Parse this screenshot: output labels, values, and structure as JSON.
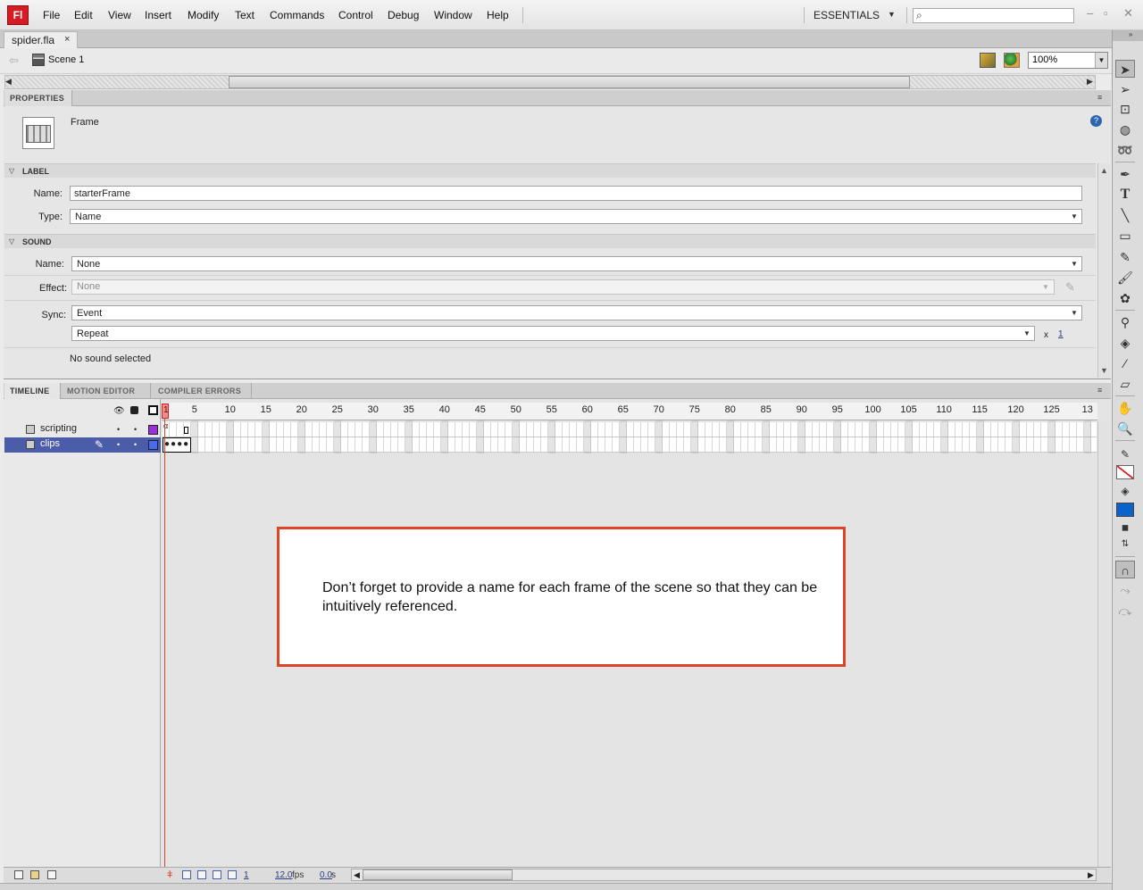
{
  "app": {
    "logo": "Fl",
    "menus": [
      "File",
      "Edit",
      "View",
      "Insert",
      "Modify",
      "Text",
      "Commands",
      "Control",
      "Debug",
      "Window",
      "Help"
    ],
    "workspace": "ESSENTIALS",
    "search": {
      "value": "",
      "placeholder": ""
    }
  },
  "document": {
    "tab_label": "spider.fla",
    "close_glyph": "×",
    "scene": "Scene 1",
    "zoom": "100%"
  },
  "properties": {
    "tab": "PROPERTIES",
    "selection_type": "Frame",
    "label_section": {
      "title": "LABEL",
      "name_label": "Name:",
      "name_value": "starterFrame",
      "type_label": "Type:",
      "type_value": "Name"
    },
    "sound_section": {
      "title": "SOUND",
      "name_label": "Name:",
      "name_value": "None",
      "effect_label": "Effect:",
      "effect_value": "None",
      "sync_label": "Sync:",
      "sync_value": "Event",
      "repeat_value": "Repeat",
      "repeat_x": "x",
      "repeat_count": "1",
      "status": "No sound selected"
    }
  },
  "timeline": {
    "tabs": [
      "TIMELINE",
      "MOTION EDITOR",
      "COMPILER ERRORS"
    ],
    "playhead": "1",
    "ruler": [
      "5",
      "10",
      "15",
      "20",
      "25",
      "30",
      "35",
      "40",
      "45",
      "50",
      "55",
      "60",
      "65",
      "70",
      "75",
      "80",
      "85",
      "90",
      "95",
      "100",
      "105",
      "110",
      "115",
      "120",
      "125",
      "13"
    ],
    "layers": [
      {
        "name": "scripting",
        "color": "#9b30d9",
        "selected": false
      },
      {
        "name": "clips",
        "color": "#4a6bf0",
        "selected": true
      }
    ],
    "current_frame": "1",
    "fps": "12.0",
    "fps_unit": "fps",
    "time": "0.0",
    "time_unit": "s"
  },
  "note": "Don’t forget to provide a name for each frame of the scene so that they can be intuitively referenced."
}
